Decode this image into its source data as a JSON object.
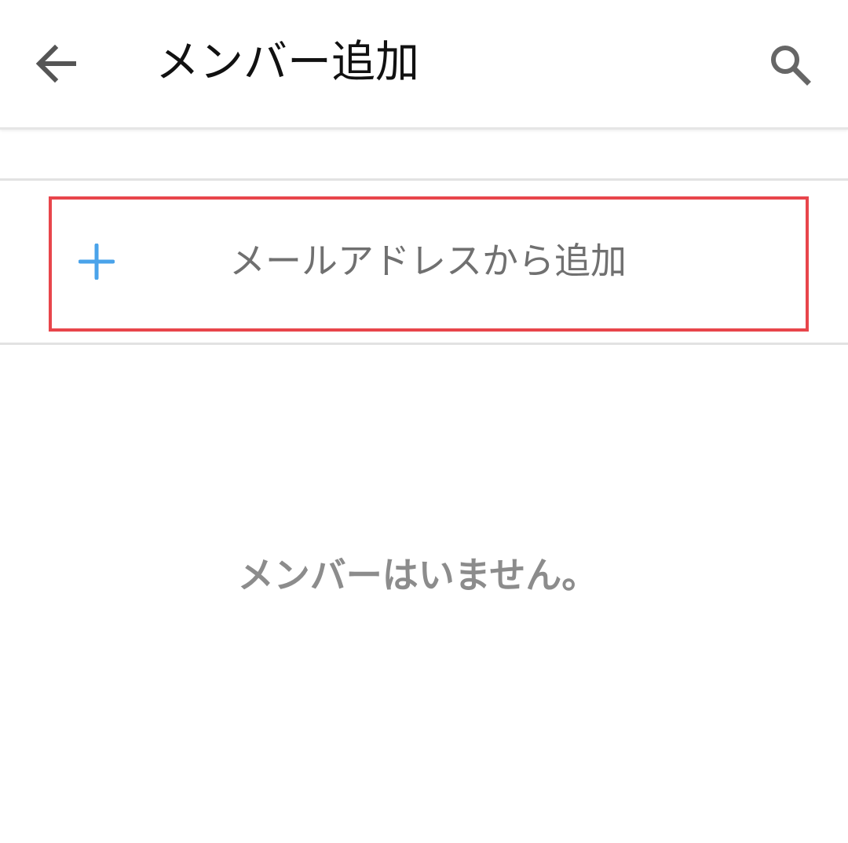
{
  "header": {
    "title": "メンバー追加",
    "back_icon": "arrow-left-icon",
    "search_icon": "search-icon"
  },
  "add_by_email": {
    "label": "メールアドレスから追加",
    "icon": "plus-icon",
    "icon_color": "#4aa3ea",
    "highlight_color": "#e8454b"
  },
  "members": {
    "empty_message": "メンバーはいません。"
  }
}
